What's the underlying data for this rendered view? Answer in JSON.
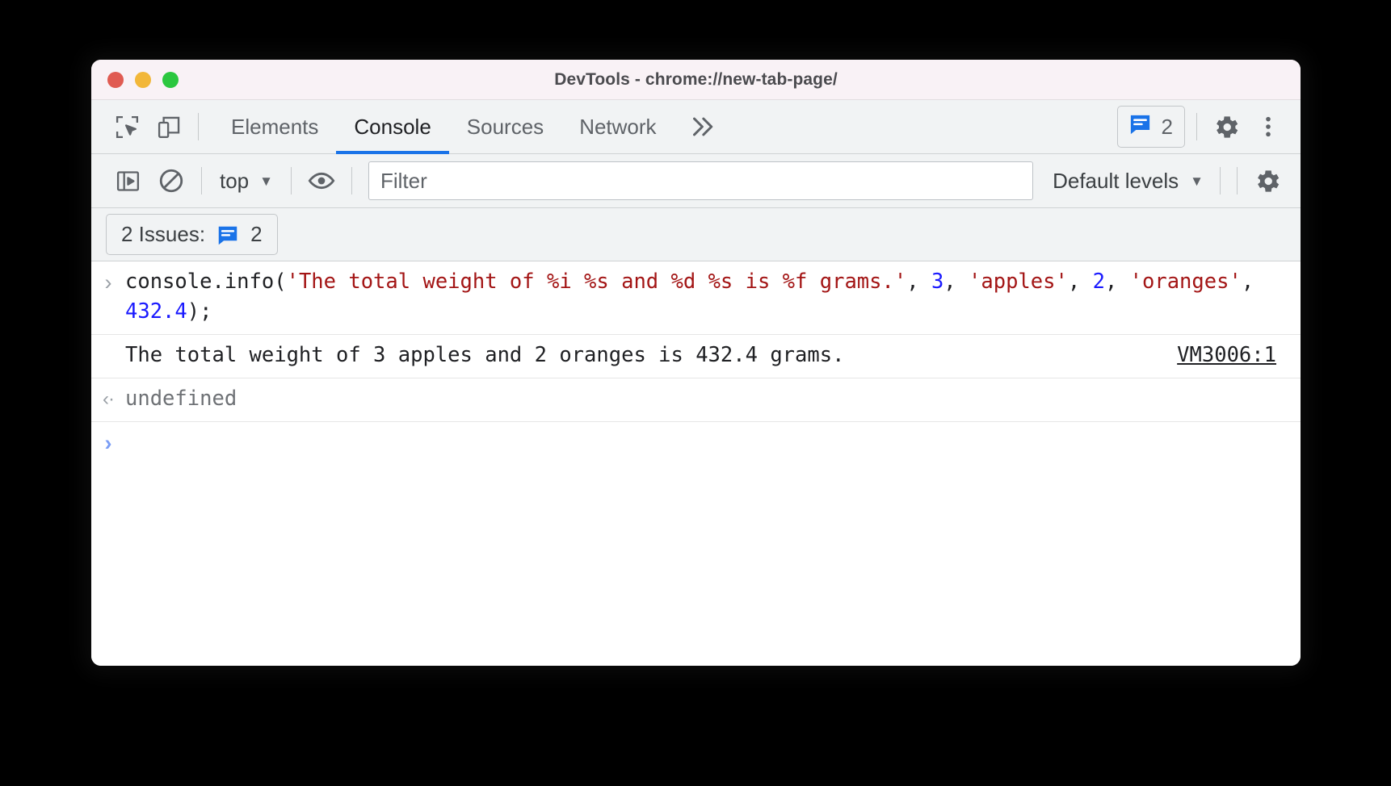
{
  "window": {
    "title": "DevTools - chrome://new-tab-page/",
    "traffic_lights": [
      {
        "name": "close",
        "color": "#e05b52"
      },
      {
        "name": "minimize",
        "color": "#f2b739"
      },
      {
        "name": "zoom",
        "color": "#2bc73f"
      }
    ]
  },
  "tabbar": {
    "inspect_icon": "inspect-element-icon",
    "device_icon": "device-toolbar-icon",
    "tabs": [
      {
        "label": "Elements",
        "active": false
      },
      {
        "label": "Console",
        "active": true
      },
      {
        "label": "Sources",
        "active": false
      },
      {
        "label": "Network",
        "active": false
      }
    ],
    "more_tabs_icon": "chevron-double-right-icon",
    "issues_badge": {
      "icon": "issues-message-icon",
      "count": "2",
      "color": "#1a73e8"
    },
    "settings_icon": "gear-icon",
    "more_options_icon": "three-dot-vertical-icon"
  },
  "console_toolbar": {
    "sidebar_toggle_icon": "console-sidebar-icon",
    "clear_console_icon": "clear-console-icon",
    "context": {
      "label": "top",
      "caret": "▼"
    },
    "live_expression_icon": "eye-icon",
    "filter": {
      "placeholder": "Filter",
      "value": ""
    },
    "levels": {
      "label": "Default levels",
      "caret": "▼"
    },
    "settings_icon": "gear-icon"
  },
  "issues_bar": {
    "label": "2 Issues:",
    "icon": "issues-message-icon",
    "count": "2"
  },
  "console": {
    "input_entry": {
      "gutter_icon": "›",
      "tokens": [
        {
          "type": "plain",
          "text": "console.info("
        },
        {
          "type": "string",
          "text": "'The total weight of %i %s and %d %s is %f grams.'"
        },
        {
          "type": "plain",
          "text": ", "
        },
        {
          "type": "number",
          "text": "3"
        },
        {
          "type": "plain",
          "text": ", "
        },
        {
          "type": "string",
          "text": "'apples'"
        },
        {
          "type": "plain",
          "text": ", "
        },
        {
          "type": "number",
          "text": "2"
        },
        {
          "type": "plain",
          "text": ", "
        },
        {
          "type": "string",
          "text": "'oranges'"
        },
        {
          "type": "plain",
          "text": ", "
        },
        {
          "type": "number",
          "text": "432.4"
        },
        {
          "type": "plain",
          "text": ");"
        }
      ]
    },
    "output_entry": {
      "text": "The total weight of 3 apples and 2 oranges is 432.4 grams.",
      "source": "VM3006:1"
    },
    "return_entry": {
      "gutter_icon": "‹·",
      "text": "undefined"
    },
    "prompt": {
      "gutter_icon": "›",
      "value": ""
    }
  }
}
